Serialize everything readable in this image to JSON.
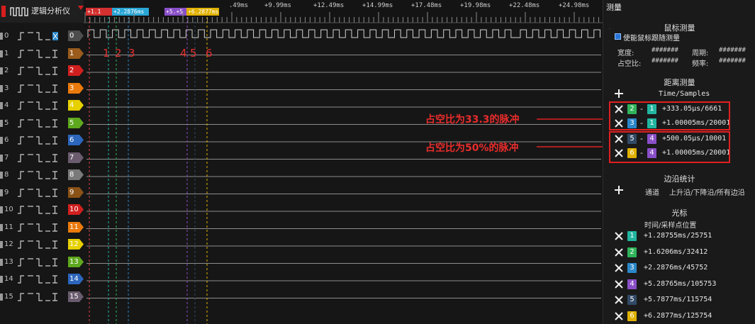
{
  "app": {
    "title": "逻辑分析仪"
  },
  "ruler": {
    "ticks": [
      "+9.99ms",
      "+12.49ms",
      "+14.99ms",
      "+17.48ms",
      "+19.98ms",
      "+22.48ms",
      "+24.98ms"
    ],
    "partial_tick": ".49ms",
    "flags": [
      {
        "label": "+1.1",
        "color": "#d33030"
      },
      {
        "label": "+2.2876ms",
        "color": "#2aa6d6"
      },
      {
        "label": "+5.+5",
        "color": "#8a4fc8"
      },
      {
        "label": "+6.2877ms",
        "color": "#e0b100"
      }
    ]
  },
  "channels": [
    {
      "num": "0",
      "label": "0",
      "color": "#4d4d4d"
    },
    {
      "num": "1",
      "label": "1",
      "color": "#9a5b1c"
    },
    {
      "num": "2",
      "label": "2",
      "color": "#d11f1f"
    },
    {
      "num": "3",
      "label": "3",
      "color": "#ea7a0c"
    },
    {
      "num": "4",
      "label": "4",
      "color": "#e6d000"
    },
    {
      "num": "5",
      "label": "5",
      "color": "#5ea81e"
    },
    {
      "num": "6",
      "label": "6",
      "color": "#2c66bd"
    },
    {
      "num": "7",
      "label": "7",
      "color": "#6a5c6e"
    },
    {
      "num": "8",
      "label": "8",
      "color": "#7a7a7a"
    },
    {
      "num": "9",
      "label": "9",
      "color": "#8a5216"
    },
    {
      "num": "10",
      "label": "10",
      "color": "#d11f1f"
    },
    {
      "num": "11",
      "label": "11",
      "color": "#ea7a0c"
    },
    {
      "num": "12",
      "label": "12",
      "color": "#e6d000"
    },
    {
      "num": "13",
      "label": "13",
      "color": "#5ea81e"
    },
    {
      "num": "14",
      "label": "14",
      "color": "#2c66bd"
    },
    {
      "num": "15",
      "label": "15",
      "color": "#6a5c6e"
    }
  ],
  "cursor_numbers": [
    "1",
    "2",
    "3",
    "4",
    "5",
    "6"
  ],
  "annotations": {
    "duty33": "占空比为33.3的脉冲",
    "duty50": "占空比为50%的脉冲"
  },
  "panel": {
    "title": "测量",
    "mouse_section": {
      "title": "鼠标测量",
      "enable_label": "使能鼠标跟随测量",
      "width_label": "宽度:",
      "width_value": "#######",
      "period_label": "周期:",
      "period_value": "#######",
      "duty_label": "占空比:",
      "duty_value": "#######",
      "freq_label": "频率:",
      "freq_value": "#######"
    },
    "distance_section": {
      "title": "距离测量",
      "column_header": "Time/Samples",
      "rows": [
        {
          "a": "2",
          "a_color": "#2fb35a",
          "b": "1",
          "b_color": "#21b5a0",
          "value": "+333.05μs/6661"
        },
        {
          "a": "3",
          "a_color": "#2a87c9",
          "b": "1",
          "b_color": "#21b5a0",
          "value": "+1.00005ms/20001"
        },
        {
          "a": "5",
          "a_color": "#324a66",
          "b": "4",
          "b_color": "#8a4fc8",
          "value": "+500.05μs/10001"
        },
        {
          "a": "6",
          "a_color": "#e0b100",
          "b": "4",
          "b_color": "#8a4fc8",
          "value": "+1.00005ms/20001"
        }
      ]
    },
    "edge_section": {
      "title": "边沿统计",
      "channel_label": "通道",
      "edge_label": "上升沿/下降沿/所有边沿"
    },
    "cursor_section": {
      "title": "光标",
      "column_header": "时间/采样点位置",
      "rows": [
        {
          "num": "1",
          "color": "#21b5a0",
          "value": "+1.28755ms/25751"
        },
        {
          "num": "2",
          "color": "#2fb35a",
          "value": "+1.6206ms/32412"
        },
        {
          "num": "3",
          "color": "#2a87c9",
          "value": "+2.2876ms/45752"
        },
        {
          "num": "4",
          "color": "#8a4fc8",
          "value": "+5.28765ms/105753"
        },
        {
          "num": "5",
          "color": "#324a66",
          "value": "+5.7877ms/115754"
        },
        {
          "num": "6",
          "color": "#e0b100",
          "value": "+6.2877ms/125754"
        }
      ]
    }
  }
}
